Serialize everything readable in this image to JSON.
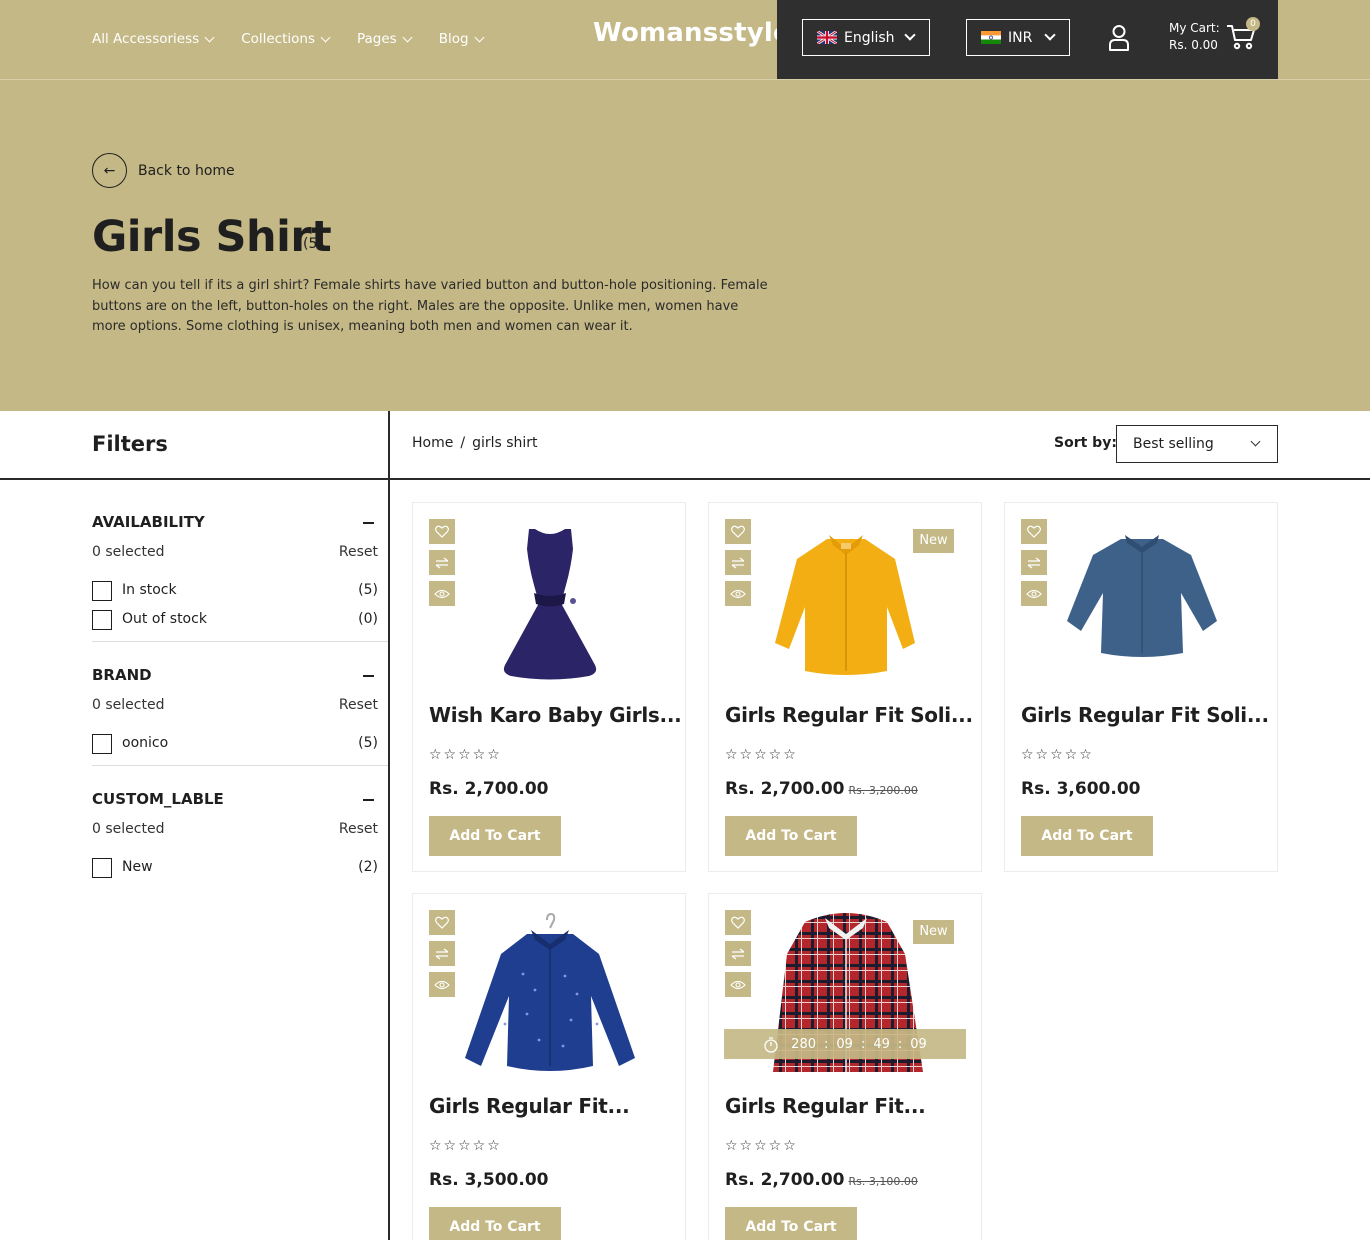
{
  "header": {
    "nav": [
      "All Accessoriess",
      "Collections",
      "Pages",
      "Blog"
    ],
    "logo": "Womansstyle",
    "language": "English",
    "currency": "INR",
    "cart_label": "My Cart:",
    "cart_total": "Rs. 0.00",
    "cart_count": "0"
  },
  "hero": {
    "back_label": "Back to home",
    "title": "Girls Shirt",
    "count": "(5)",
    "description": "How can you tell if its a girl shirt? Female shirts have varied button and button-hole positioning. Female buttons are on the left, button-holes on the right. Males are the opposite. Unlike men, women have more options. Some clothing is unisex, meaning both men and women can wear it."
  },
  "toolbar": {
    "filters_title": "Filters",
    "breadcrumb": [
      "Home",
      "girls shirt"
    ],
    "breadcrumb_sep": "/",
    "sort_label": "Sort by:",
    "sort_value": "Best selling"
  },
  "filters": [
    {
      "title": "AVAILABILITY",
      "selected": "0 selected",
      "reset": "Reset",
      "options": [
        {
          "label": "In stock",
          "count": "(5)"
        },
        {
          "label": "Out of stock",
          "count": "(0)"
        }
      ]
    },
    {
      "title": "BRAND",
      "selected": "0 selected",
      "reset": "Reset",
      "options": [
        {
          "label": "oonico",
          "count": "(5)"
        }
      ]
    },
    {
      "title": "CUSTOM_LABLE",
      "selected": "0 selected",
      "reset": "Reset",
      "options": [
        {
          "label": "New",
          "count": "(2)"
        }
      ]
    }
  ],
  "products": [
    {
      "name": "Wish Karo Baby Girls...",
      "rating": "☆☆☆☆☆",
      "price": "Rs. 2,700.00",
      "old_price": "",
      "badge": "",
      "cta": "Add To Cart",
      "color": "#2b2466"
    },
    {
      "name": "Girls Regular Fit Soli...",
      "rating": "☆☆☆☆☆",
      "price": "Rs. 2,700.00",
      "old_price": "Rs. 3,200.00",
      "badge": "New",
      "cta": "Add To Cart",
      "color": "#f2ae12"
    },
    {
      "name": "Girls Regular Fit Soli...",
      "rating": "☆☆☆☆☆",
      "price": "Rs. 3,600.00",
      "old_price": "",
      "badge": "",
      "cta": "Add To Cart",
      "color": "#3e6189"
    },
    {
      "name": "Girls Regular Fit...",
      "rating": "☆☆☆☆☆",
      "price": "Rs. 3,500.00",
      "old_price": "",
      "badge": "",
      "cta": "Add To Cart",
      "color": "#1f3e8f"
    },
    {
      "name": "Girls Regular Fit...",
      "rating": "☆☆☆☆☆",
      "price": "Rs. 2,700.00",
      "old_price": "Rs. 3,100.00",
      "badge": "New",
      "cta": "Add To Cart",
      "color": "#b3262b",
      "countdown": {
        "days": "280",
        "hours": "09",
        "minutes": "49",
        "seconds": "09",
        "sep": ":"
      }
    }
  ],
  "theme": {
    "accent": "#c4b886",
    "dark": "#2f2f2f",
    "text": "#1f1f1f"
  },
  "icons": {
    "wishlist": "heart-icon",
    "compare": "compare-arrows-icon",
    "quickview": "eye-icon",
    "timer": "stopwatch-icon",
    "user": "user-icon",
    "cart": "cart-icon",
    "back": "arrow-left-icon"
  }
}
